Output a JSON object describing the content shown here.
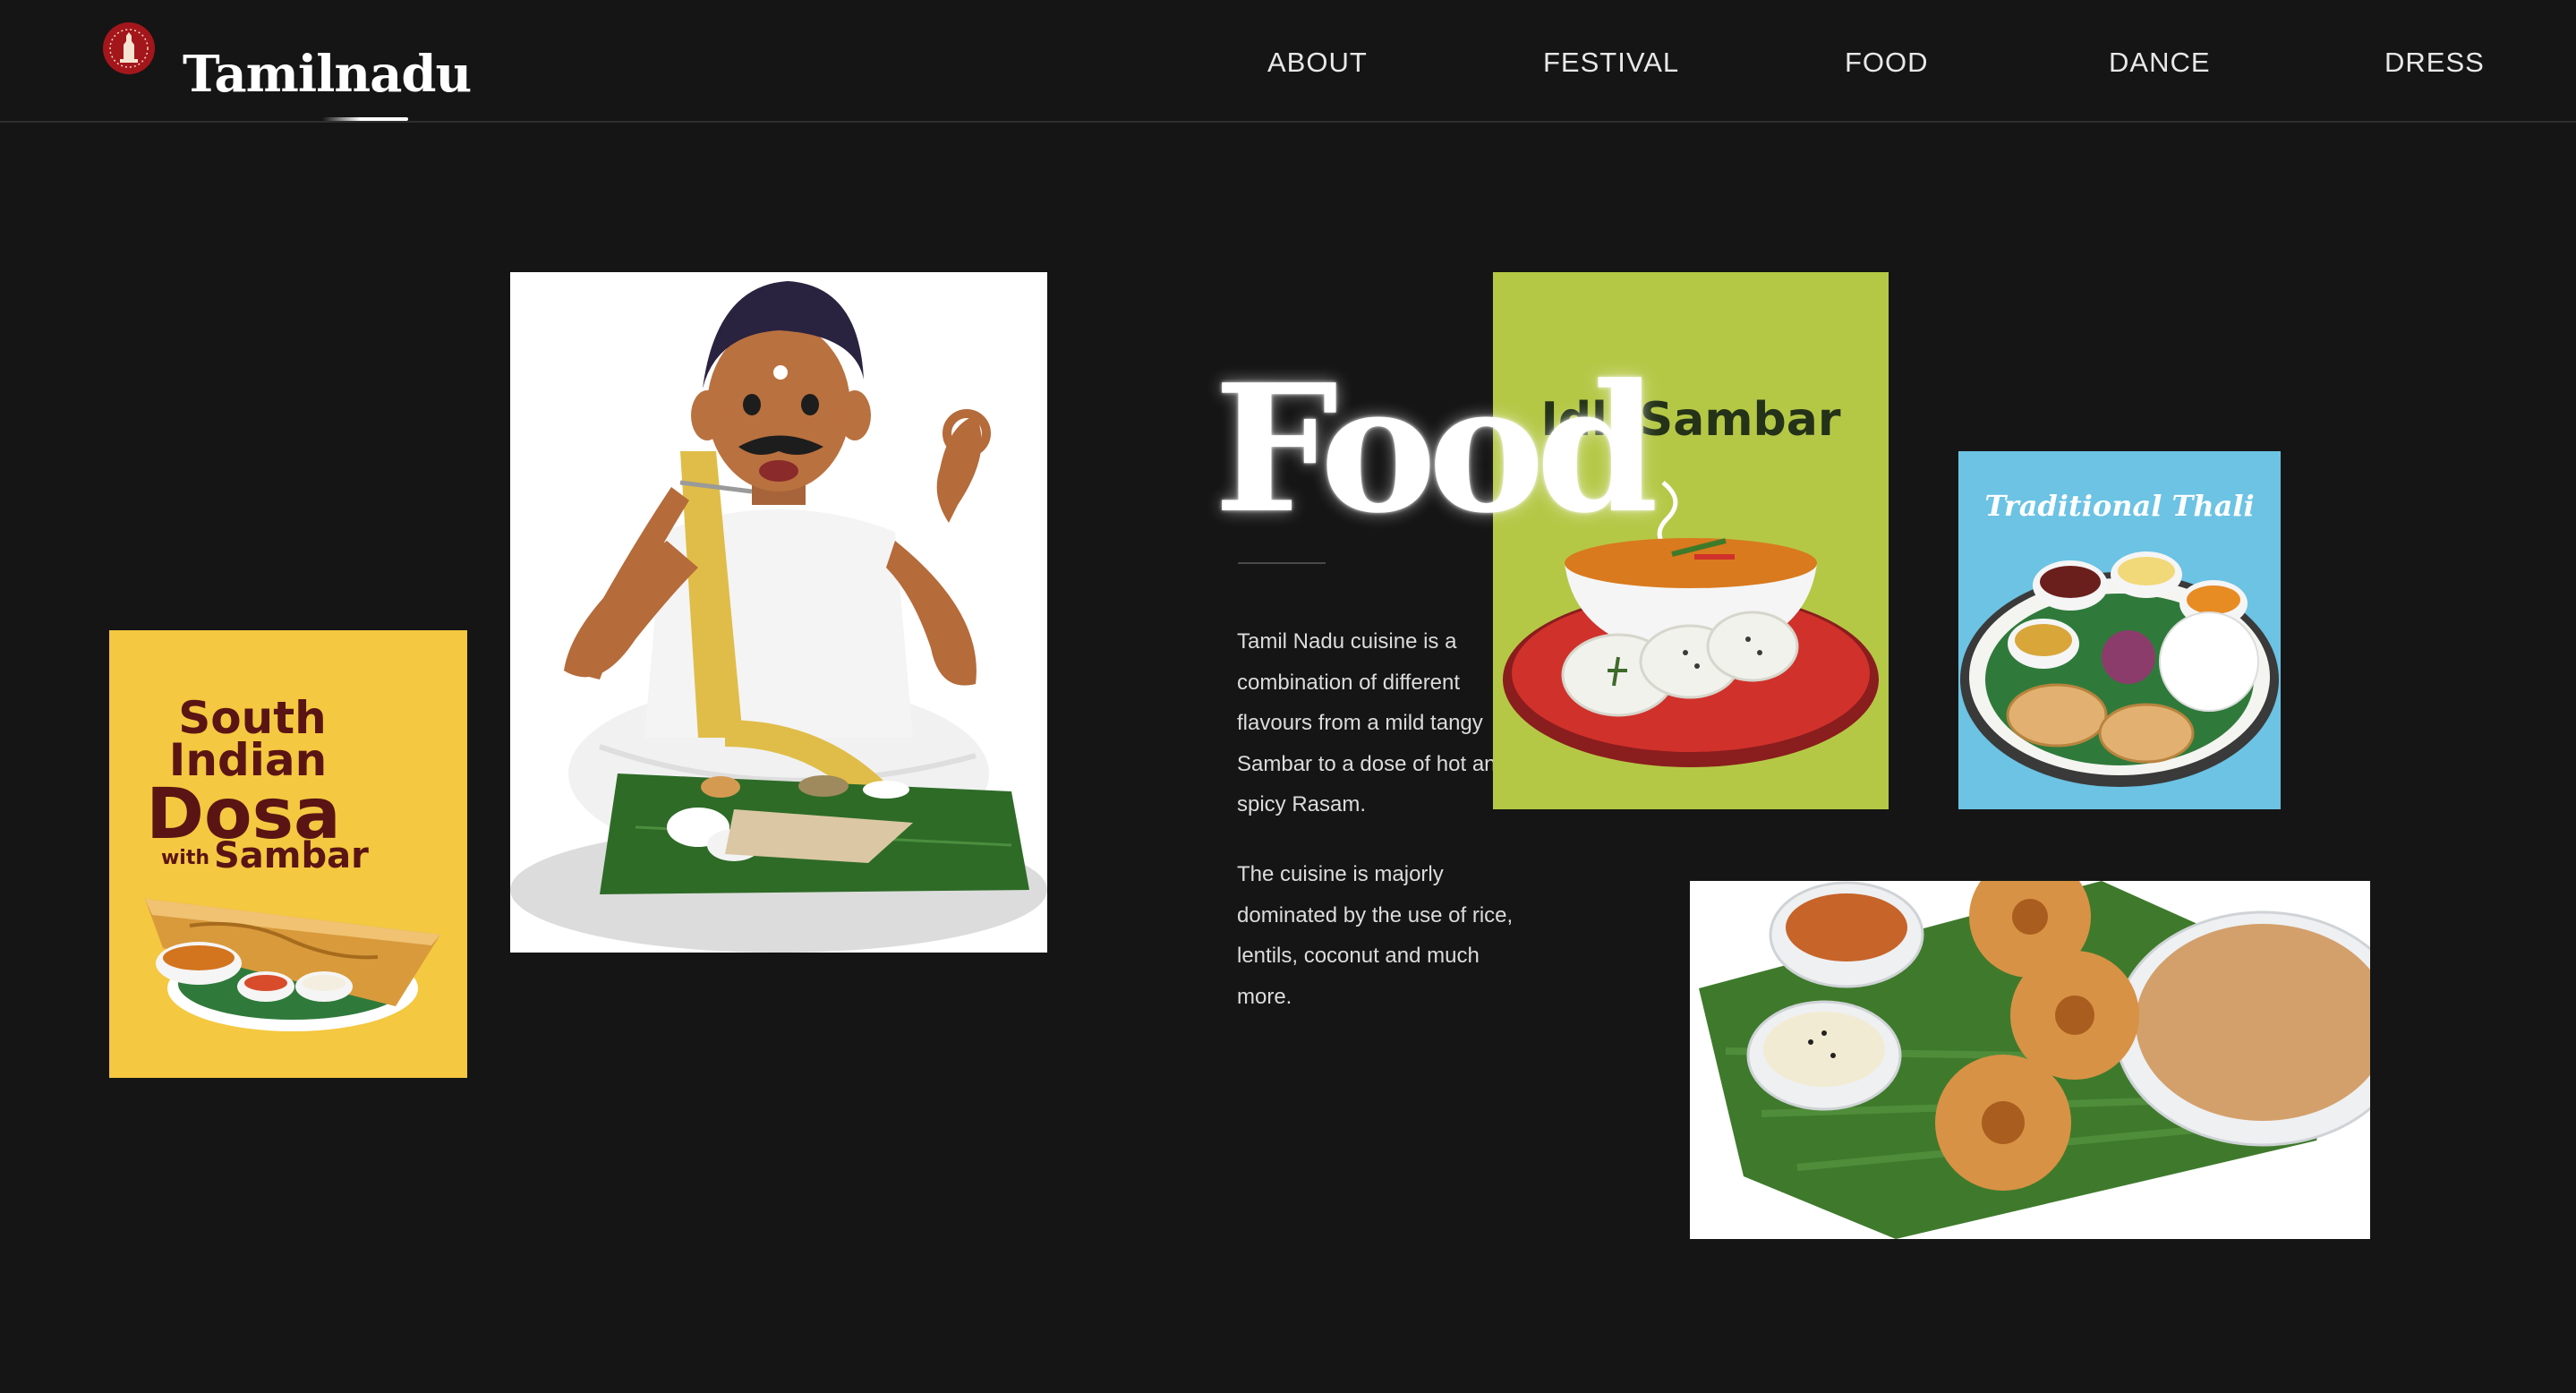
{
  "header": {
    "brand": "Tamilnadu",
    "logo_icon": "emblem-icon",
    "nav": [
      {
        "label": "ABOUT"
      },
      {
        "label": "FESTIVAL"
      },
      {
        "label": "FOOD"
      },
      {
        "label": "DANCE"
      },
      {
        "label": "DRESS"
      }
    ]
  },
  "main": {
    "title": "Food",
    "paragraphs": [
      "Tamil Nadu cuisine is a combination of different flavours from a mild tangy Sambar to a dose of hot and spicy Rasam.",
      "The cuisine is majorly dominated by the use of rice, lentils, coconut and much more."
    ]
  },
  "images": {
    "dosa": {
      "line1": "South",
      "line2": "Indian",
      "line3": "Dosa",
      "with": "with",
      "line4": "Sambar"
    },
    "man_eating": {},
    "idli": {
      "title": "Idli Sambar"
    },
    "thali": {
      "title": "Traditional Thali"
    },
    "vada": {}
  },
  "colors": {
    "background": "#151515",
    "text": "#ffffff",
    "dosa_card": "#f4c840",
    "idli_card": "#b5c846",
    "thali_card": "#6cc3e4",
    "leaf_green": "#2e6b27"
  }
}
